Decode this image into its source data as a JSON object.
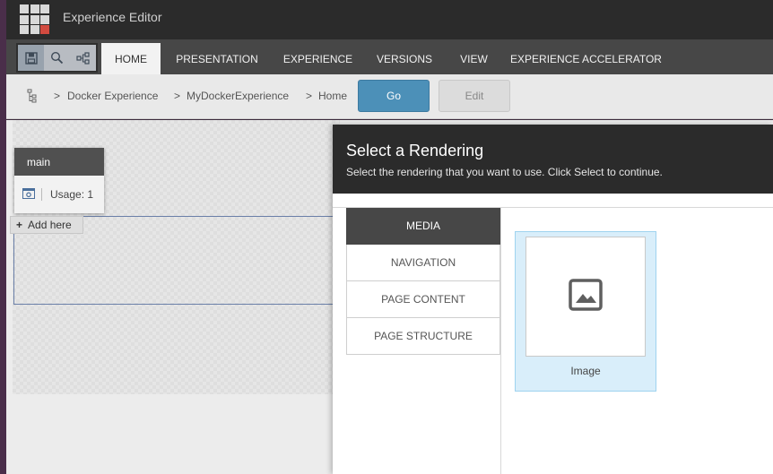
{
  "app": {
    "title": "Experience Editor"
  },
  "ribbon": {
    "tabs": [
      {
        "label": "HOME",
        "active": true
      },
      {
        "label": "PRESENTATION",
        "active": false
      },
      {
        "label": "EXPERIENCE",
        "active": false
      },
      {
        "label": "VERSIONS",
        "active": false
      },
      {
        "label": "VIEW",
        "active": false
      },
      {
        "label": "EXPERIENCE ACCELERATOR",
        "active": false
      }
    ],
    "quick_icons": [
      "save-icon",
      "search-icon",
      "sitemap-icon"
    ]
  },
  "breadcrumb": {
    "items": [
      "Docker Experience",
      "MyDockerExperience",
      "Home"
    ],
    "separator": ">",
    "go_label": "Go",
    "edit_label": "Edit"
  },
  "placeholder": {
    "name": "main",
    "usage": "Usage: 1",
    "add_here": "Add here"
  },
  "dialog": {
    "title": "Select a Rendering",
    "subtitle": "Select the rendering that you want to use. Click Select to continue.",
    "categories": [
      {
        "label": "MEDIA",
        "active": true
      },
      {
        "label": "NAVIGATION",
        "active": false
      },
      {
        "label": "PAGE CONTENT",
        "active": false
      },
      {
        "label": "PAGE STRUCTURE",
        "active": false
      }
    ],
    "renderings": [
      {
        "label": "Image",
        "icon": "image-icon",
        "selected": true
      }
    ]
  },
  "colors": {
    "topbar": "#2b2b2b",
    "ribbon": "#474747",
    "go_button": "#4c90b8",
    "selected_tile": "#d9eefa",
    "logo_accent": "#d24a3f"
  }
}
